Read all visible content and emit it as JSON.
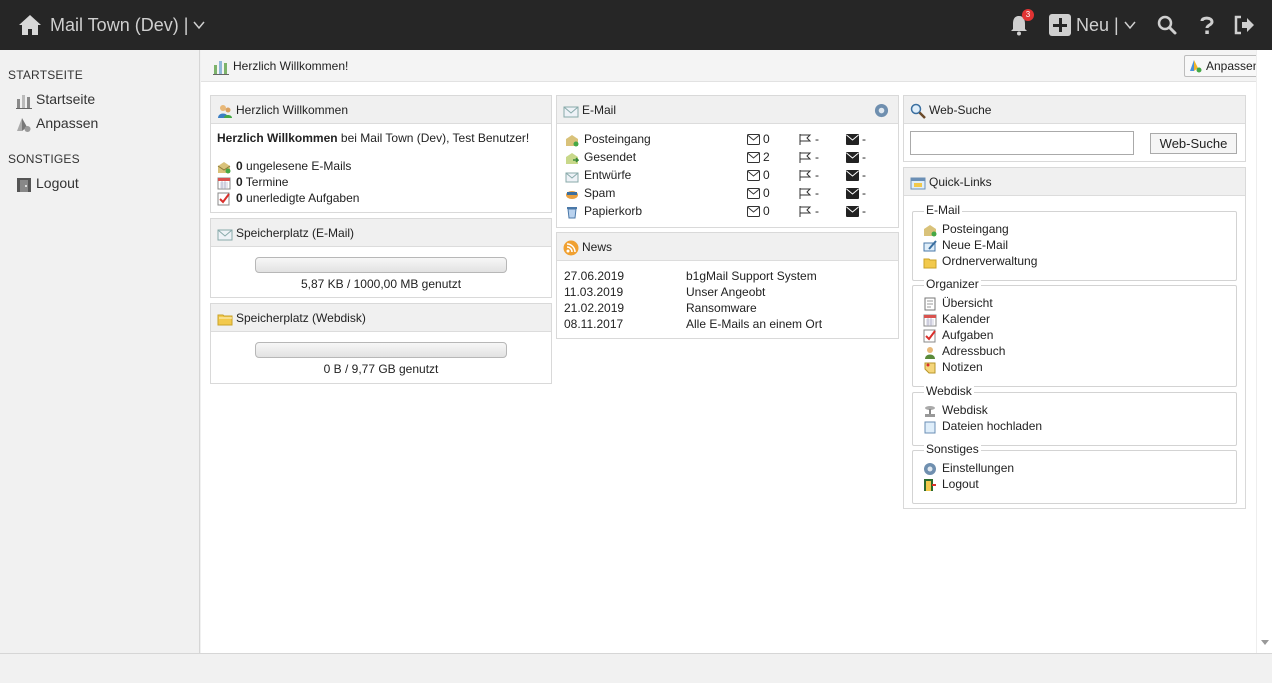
{
  "topbar": {
    "app_title": "Mail Town (Dev) |",
    "notification_count": "3",
    "new_label": "Neu |",
    "icons": [
      "home-icon",
      "bell-icon",
      "plus-icon",
      "search-icon",
      "help-icon",
      "logout-icon"
    ]
  },
  "sidebar": {
    "section1": "STARTSEITE",
    "section2": "SONSTIGES",
    "items": [
      {
        "label": "Startseite",
        "icon": "dashboard-icon"
      },
      {
        "label": "Anpassen",
        "icon": "customize-icon"
      },
      {
        "label": "Logout",
        "icon": "door-icon"
      }
    ]
  },
  "header": {
    "title": "Herzlich Willkommen!",
    "customize_label": "Anpassen"
  },
  "welcome": {
    "title": "Herzlich Willkommen",
    "greeting_bold": "Herzlich Willkommen",
    "greeting_rest": " bei Mail Town (Dev), Test Benutzer!",
    "stats": [
      {
        "count": "0",
        "label": " ungelesene E-Mails"
      },
      {
        "count": "0",
        "label": " Termine"
      },
      {
        "count": "0",
        "label": " unerledigte Aufgaben"
      }
    ]
  },
  "storage_email": {
    "title": "Speicherplatz (E-Mail)",
    "used_fraction": 0.0,
    "label": "5,87 KB / 1000,00 MB genutzt"
  },
  "storage_webdisk": {
    "title": "Speicherplatz (Webdisk)",
    "used_fraction": 0.0,
    "label": "0 B / 9,77 GB genutzt"
  },
  "email": {
    "title": "E-Mail",
    "folders": [
      {
        "name": "Posteingang",
        "count": "0",
        "flagged": "-",
        "unread": "-"
      },
      {
        "name": "Gesendet",
        "count": "2",
        "flagged": "-",
        "unread": "-"
      },
      {
        "name": "Entwürfe",
        "count": "0",
        "flagged": "-",
        "unread": "-"
      },
      {
        "name": "Spam",
        "count": "0",
        "flagged": "-",
        "unread": "-"
      },
      {
        "name": "Papierkorb",
        "count": "0",
        "flagged": "-",
        "unread": "-"
      }
    ]
  },
  "news": {
    "title": "News",
    "items": [
      {
        "date": "27.06.2019",
        "title": "b1gMail Support System"
      },
      {
        "date": "11.03.2019",
        "title": "Unser Angeobt"
      },
      {
        "date": "21.02.2019",
        "title": "Ransomware"
      },
      {
        "date": "08.11.2017",
        "title": "Alle E-Mails an einem Ort"
      }
    ]
  },
  "websearch": {
    "title": "Web-Suche",
    "value": "",
    "button": "Web-Suche"
  },
  "quicklinks": {
    "title": "Quick-Links",
    "groups": [
      {
        "legend": "E-Mail",
        "links": [
          "Posteingang",
          "Neue E-Mail",
          "Ordnerverwaltung"
        ]
      },
      {
        "legend": "Organizer",
        "links": [
          "Übersicht",
          "Kalender",
          "Aufgaben",
          "Adressbuch",
          "Notizen"
        ]
      },
      {
        "legend": "Webdisk",
        "links": [
          "Webdisk",
          "Dateien hochladen"
        ]
      },
      {
        "legend": "Sonstiges",
        "links": [
          "Einstellungen",
          "Logout"
        ]
      }
    ]
  },
  "colors": {
    "topbar_bg": "#262626",
    "topbar_fg": "#cfcfcf",
    "badge": "#e03333",
    "widget_header": "#f0f0f0"
  }
}
